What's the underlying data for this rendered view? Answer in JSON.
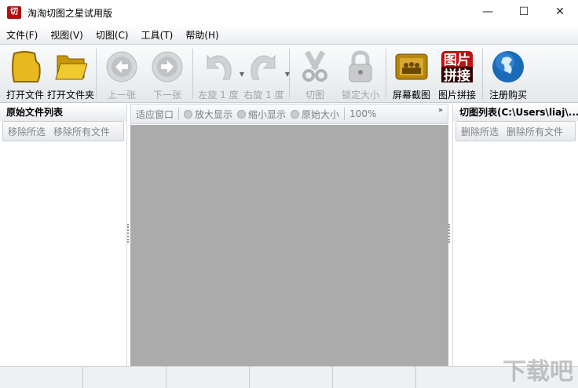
{
  "window": {
    "title": "淘淘切图之星试用版",
    "logo_text": "切",
    "min": "—",
    "max": "☐",
    "close": "✕"
  },
  "menu": [
    "文件(F)",
    "视图(V)",
    "切图(C)",
    "工具(T)",
    "帮助(H)"
  ],
  "toolbar": [
    {
      "label": "打开文件",
      "icon": "open-file-icon",
      "enabled": true
    },
    {
      "label": "打开文件夹",
      "icon": "open-folder-icon",
      "enabled": true
    },
    {
      "label": "上一张",
      "icon": "previous-icon",
      "enabled": false
    },
    {
      "label": "下一张",
      "icon": "next-icon",
      "enabled": false
    },
    {
      "label": "左旋 1 度",
      "icon": "rotate-left-icon",
      "enabled": false
    },
    {
      "label": "右旋 1 度",
      "icon": "rotate-right-icon",
      "enabled": false
    },
    {
      "label": "切图",
      "icon": "scissors-icon",
      "enabled": false
    },
    {
      "label": "锁定大小",
      "icon": "lock-icon",
      "enabled": false
    },
    {
      "label": "屏幕截图",
      "icon": "screenshot-icon",
      "enabled": true
    },
    {
      "label": "图片拼接",
      "icon": "image-join-icon",
      "enabled": true,
      "icon_text": "图片拼接"
    },
    {
      "label": "注册购买",
      "icon": "globe-icon",
      "enabled": true
    }
  ],
  "left_panel": {
    "title": "原始文件列表",
    "actions": [
      "移除所选",
      "移除所有文件"
    ]
  },
  "center": {
    "fit": "适应窗口",
    "zoom_in": "放大显示",
    "zoom_out": "缩小显示",
    "original": "原始大小",
    "zoom_level": "100%",
    "more": "»"
  },
  "right_panel": {
    "title": "切图列表(C:\\Users\\liaj\\...",
    "actions": [
      "删除所选",
      "删除所有文件"
    ]
  },
  "watermark": "下载吧"
}
